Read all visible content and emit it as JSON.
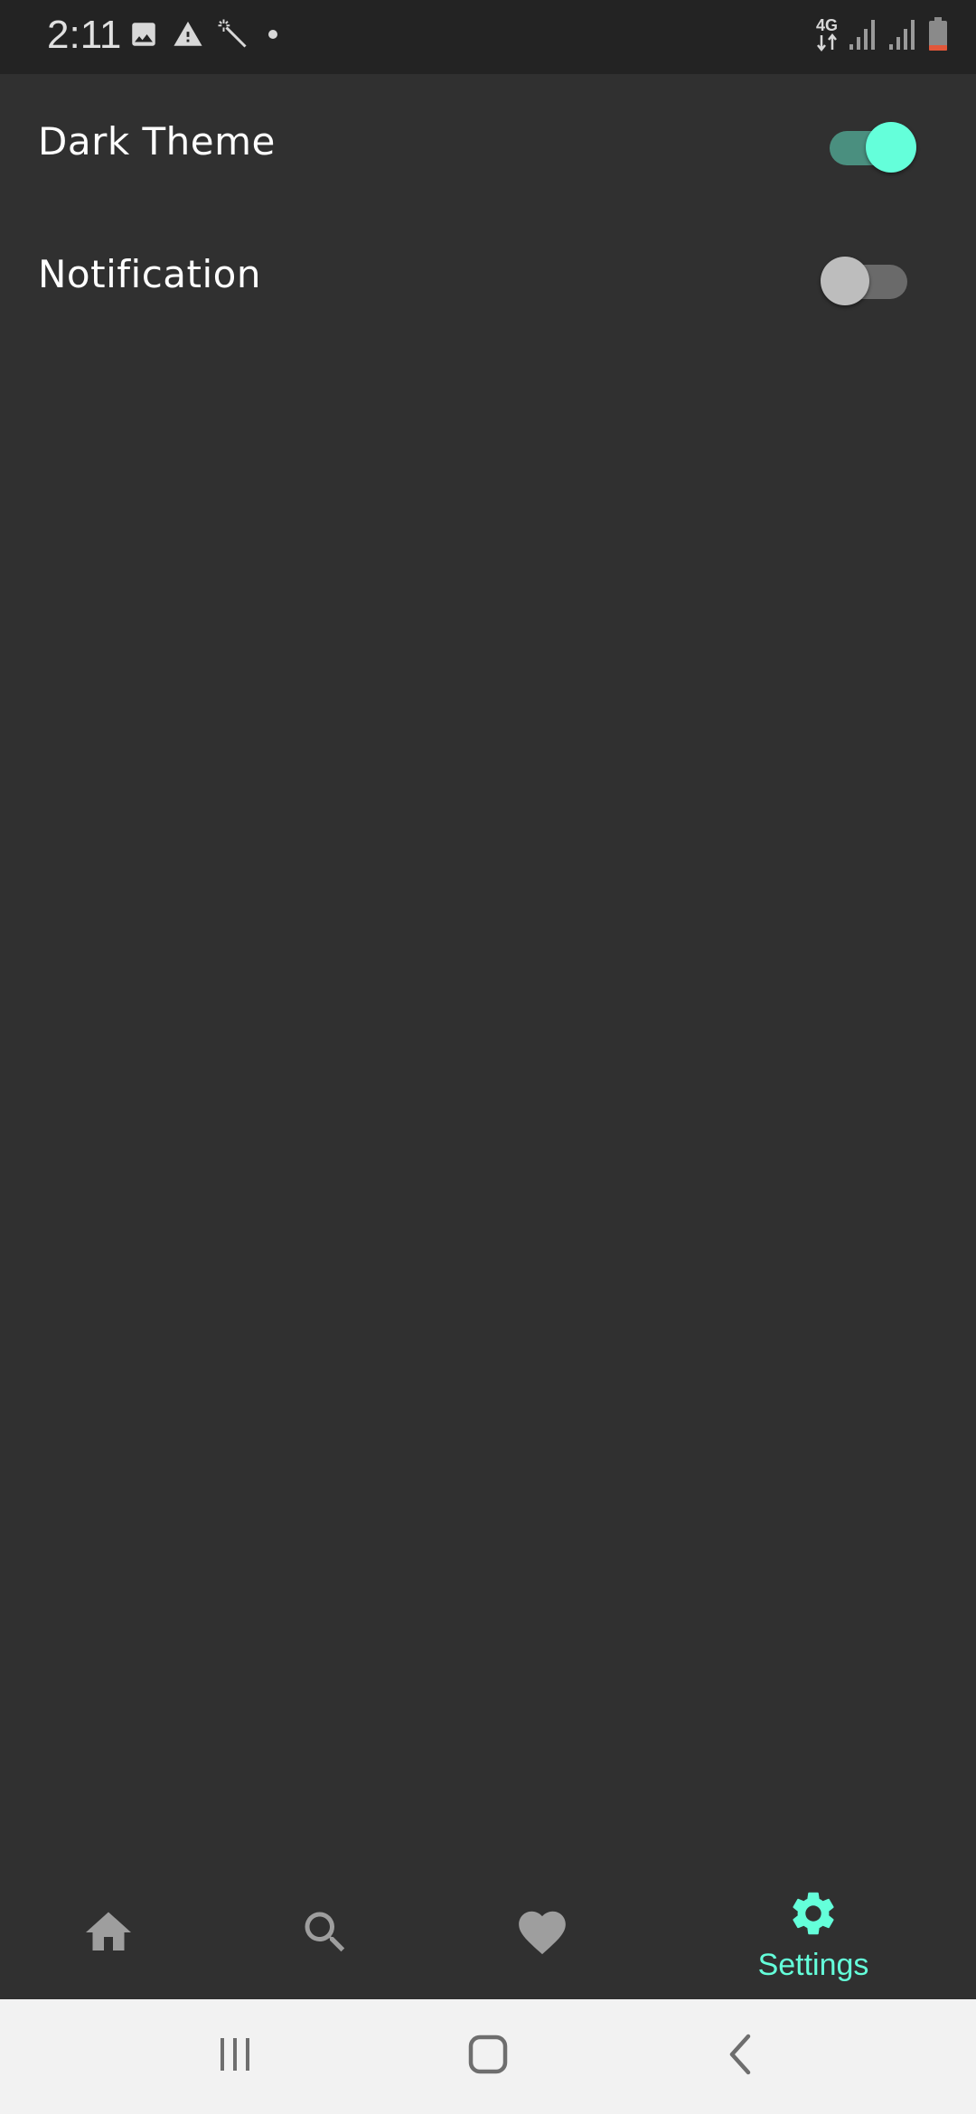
{
  "status_bar": {
    "time": "2:11",
    "network_label": "4G",
    "icons_left": [
      "image-icon",
      "warning-icon",
      "magic-wand-icon",
      "dot-icon"
    ],
    "icons_right": [
      "network-4g-icon",
      "signal-icon",
      "signal-icon",
      "battery-icon"
    ]
  },
  "settings": {
    "dark_theme": {
      "label": "Dark Theme",
      "enabled": true
    },
    "notification": {
      "label": "Notification",
      "enabled": false
    }
  },
  "bottom_nav": {
    "items": [
      {
        "name": "home",
        "icon": "home-icon",
        "label": "",
        "active": false
      },
      {
        "name": "search",
        "icon": "search-icon",
        "label": "",
        "active": false
      },
      {
        "name": "favorites",
        "icon": "heart-icon",
        "label": "",
        "active": false
      },
      {
        "name": "settings",
        "icon": "gear-icon",
        "label": "Settings",
        "active": true
      }
    ]
  },
  "system_nav": {
    "buttons": [
      "recent-apps-icon",
      "home-button-icon",
      "back-icon"
    ]
  },
  "colors": {
    "background": "#303030",
    "status_bar": "#232323",
    "accent": "#64ffda",
    "accent_track": "#4a8f7f",
    "inactive_icon": "#9e9e9e",
    "toggle_off_thumb": "#bdbdbd",
    "toggle_off_track": "#6a6a6a",
    "system_nav_bg": "#f2f2f2"
  }
}
